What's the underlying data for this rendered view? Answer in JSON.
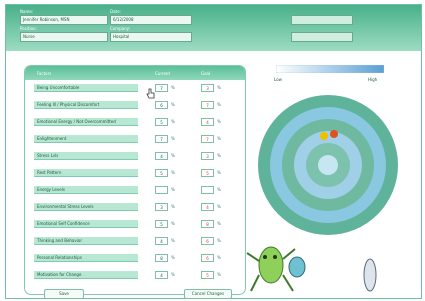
{
  "header": {
    "name_label": "Name:",
    "name_value": "Jennifer Robinson, MSN",
    "date_label": "Date:",
    "date_value": "6/12/2008",
    "position_label": "Position:",
    "position_value": "Nurse",
    "company_label": "Company:",
    "company_value": "Hospital"
  },
  "table": {
    "col_factors": "Factors",
    "col_current": "Current",
    "col_goal": "Goal",
    "rows": [
      {
        "label": "Being Uncomfortable",
        "current": "7",
        "goal": "3"
      },
      {
        "label": "Feeling Ill / Physical Discomfort",
        "current": "6",
        "goal": "7"
      },
      {
        "label": "Emotional Energy / Not Overcommitted",
        "current": "5",
        "goal": "4"
      },
      {
        "label": "Enlightenment",
        "current": "7",
        "goal": "7"
      },
      {
        "label": "Stress Lvls",
        "current": "4",
        "goal": "3"
      },
      {
        "label": "Rest Pattern",
        "current": "5",
        "goal": "5"
      },
      {
        "label": "Energy Levels",
        "current": "",
        "goal": ""
      },
      {
        "label": "Environmental Stress Levels",
        "current": "3",
        "goal": "4"
      },
      {
        "label": "Emotional Self Confidence",
        "current": "5",
        "goal": "8"
      },
      {
        "label": "Thinking and Behavior",
        "current": "4",
        "goal": "6"
      },
      {
        "label": "Personal Relationships",
        "current": "8",
        "goal": "6"
      },
      {
        "label": "Motivation for Change",
        "current": "4",
        "goal": "5"
      }
    ]
  },
  "buttons": {
    "save": "Save",
    "cancel": "Cancel Changes"
  },
  "scale": {
    "left": "Low",
    "right": "High"
  },
  "colors": {
    "header": "#48b08a",
    "row": "#b8e7d3",
    "goal_text": "#d23b2b",
    "target_ring": "#5fb39a"
  }
}
